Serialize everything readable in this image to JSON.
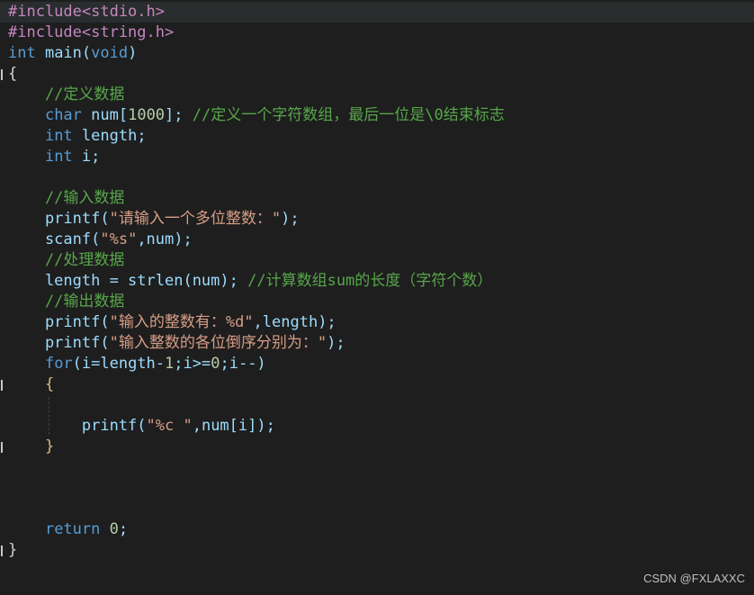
{
  "colors": {
    "background": "#1e1e1e",
    "preprocessor": "#c586c0",
    "keyword": "#569cd6",
    "identifier": "#9cdcfe",
    "plain": "#d4d4d4",
    "comment": "#57a64a",
    "string": "#d69d85",
    "number": "#b5cea8",
    "function": "#dcdcaa",
    "brace": "#d4d4d4",
    "brace_inner": "#d7ba7d"
  },
  "editor": {
    "lines": [
      [
        {
          "t": "#include<stdio.h>",
          "c": "preprocessor"
        }
      ],
      [
        {
          "t": "#include<string.h>",
          "c": "preprocessor"
        }
      ],
      [
        {
          "t": "int",
          "c": "keyword"
        },
        {
          "t": " main(",
          "c": "identifier"
        },
        {
          "t": "void",
          "c": "keyword"
        },
        {
          "t": ")",
          "c": "identifier"
        }
      ],
      [
        {
          "t": "{",
          "c": "brace"
        }
      ],
      [
        {
          "t": "    //定义数据",
          "c": "comment"
        }
      ],
      [
        {
          "t": "    ",
          "c": "plain"
        },
        {
          "t": "char",
          "c": "keyword"
        },
        {
          "t": " num[",
          "c": "identifier"
        },
        {
          "t": "1000",
          "c": "number"
        },
        {
          "t": "]; ",
          "c": "identifier"
        },
        {
          "t": "//定义一个字符数组，最后一位是\\0结束标志",
          "c": "comment"
        }
      ],
      [
        {
          "t": "    ",
          "c": "plain"
        },
        {
          "t": "int",
          "c": "keyword"
        },
        {
          "t": " length;",
          "c": "identifier"
        }
      ],
      [
        {
          "t": "    ",
          "c": "plain"
        },
        {
          "t": "int",
          "c": "keyword"
        },
        {
          "t": " i;",
          "c": "identifier"
        }
      ],
      [],
      [
        {
          "t": "    //输入数据",
          "c": "comment"
        }
      ],
      [
        {
          "t": "    printf(",
          "c": "identifier"
        },
        {
          "t": "\"请输入一个多位整数：\"",
          "c": "string"
        },
        {
          "t": ");",
          "c": "identifier"
        }
      ],
      [
        {
          "t": "    scanf(",
          "c": "identifier"
        },
        {
          "t": "\"%s\"",
          "c": "string"
        },
        {
          "t": ",num);",
          "c": "identifier"
        }
      ],
      [
        {
          "t": "    //处理数据",
          "c": "comment"
        }
      ],
      [
        {
          "t": "    length = strlen(num); ",
          "c": "identifier"
        },
        {
          "t": "//计算数组sum的长度（字符个数）",
          "c": "comment"
        }
      ],
      [
        {
          "t": "    //输出数据",
          "c": "comment"
        }
      ],
      [
        {
          "t": "    printf(",
          "c": "identifier"
        },
        {
          "t": "\"输入的整数有：%d\"",
          "c": "string"
        },
        {
          "t": ",length);",
          "c": "identifier"
        }
      ],
      [
        {
          "t": "    printf(",
          "c": "identifier"
        },
        {
          "t": "\"输入整数的各位倒序分别为：\"",
          "c": "string"
        },
        {
          "t": ");",
          "c": "identifier"
        }
      ],
      [
        {
          "t": "    ",
          "c": "plain"
        },
        {
          "t": "for",
          "c": "keyword"
        },
        {
          "t": "(i=length-",
          "c": "identifier"
        },
        {
          "t": "1",
          "c": "number"
        },
        {
          "t": ";i>=",
          "c": "identifier"
        },
        {
          "t": "0",
          "c": "number"
        },
        {
          "t": ";i--)",
          "c": "identifier"
        }
      ],
      [
        {
          "t": "    {",
          "c": "brace_inner"
        }
      ],
      [],
      [
        {
          "t": "        printf(",
          "c": "identifier"
        },
        {
          "t": "\"%c \"",
          "c": "string"
        },
        {
          "t": ",num[i]);",
          "c": "identifier"
        }
      ],
      [
        {
          "t": "    }",
          "c": "brace_inner"
        }
      ],
      [],
      [],
      [],
      [
        {
          "t": "    ",
          "c": "plain"
        },
        {
          "t": "return",
          "c": "keyword"
        },
        {
          "t": " ",
          "c": "plain"
        },
        {
          "t": "0",
          "c": "number"
        },
        {
          "t": ";",
          "c": "identifier"
        }
      ],
      [
        {
          "t": "}",
          "c": "brace"
        }
      ]
    ]
  },
  "watermark": {
    "text": "CSDN @FXLAXXC"
  }
}
